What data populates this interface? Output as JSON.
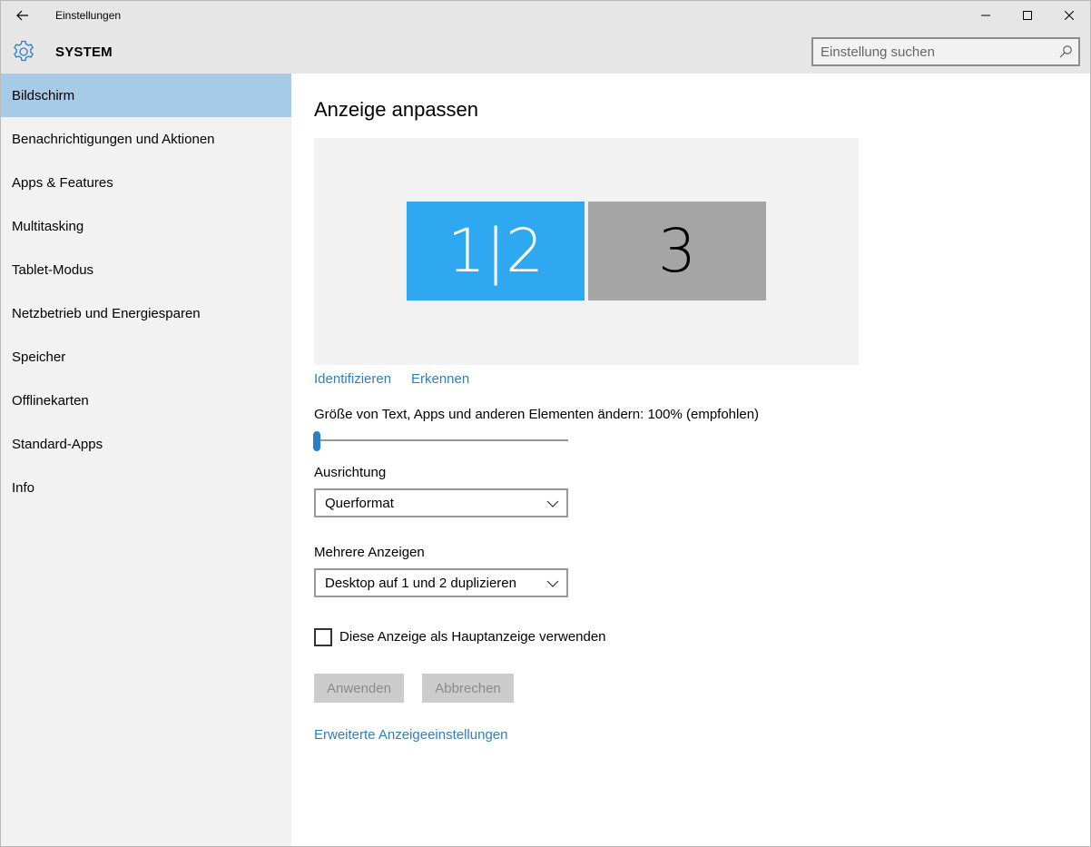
{
  "window": {
    "title": "Einstellungen",
    "back_icon": "back-arrow-icon",
    "minimize_icon": "minimize-icon",
    "maximize_icon": "maximize-icon",
    "close_icon": "close-icon"
  },
  "header": {
    "icon": "gear-icon",
    "title": "SYSTEM",
    "search_placeholder": "Einstellung suchen",
    "search_value": ""
  },
  "sidebar": {
    "active_index": 0,
    "items": [
      {
        "label": "Bildschirm"
      },
      {
        "label": "Benachrichtigungen und Aktionen"
      },
      {
        "label": "Apps & Features"
      },
      {
        "label": "Multitasking"
      },
      {
        "label": "Tablet-Modus"
      },
      {
        "label": "Netzbetrieb und Energiesparen"
      },
      {
        "label": "Speicher"
      },
      {
        "label": "Offlinekarten"
      },
      {
        "label": "Standard-Apps"
      },
      {
        "label": "Info"
      }
    ]
  },
  "main": {
    "title": "Anzeige anpassen",
    "monitors": [
      {
        "label": "1|2",
        "selected": true
      },
      {
        "label": "3",
        "selected": false
      }
    ],
    "identify_link": "Identifizieren",
    "detect_link": "Erkennen",
    "scale_label": "Größe von Text, Apps und anderen Elementen ändern: 100% (empfohlen)",
    "scale_slider_fraction": 0,
    "orientation_label": "Ausrichtung",
    "orientation_value": "Querformat",
    "multi_display_label": "Mehrere Anzeigen",
    "multi_display_value": "Desktop auf 1 und 2 duplizieren",
    "main_display_checkbox_label": "Diese Anzeige als Hauptanzeige verwenden",
    "main_display_checked": false,
    "apply_button": "Anwenden",
    "cancel_button": "Abbrechen",
    "advanced_link": "Erweiterte Anzeigeeinstellungen"
  },
  "colors": {
    "accent": "#2b7fc7",
    "selected_monitor": "#2ea8f0",
    "unselected_monitor": "#a5a5a5",
    "sidebar_active": "#a7cbe6"
  }
}
